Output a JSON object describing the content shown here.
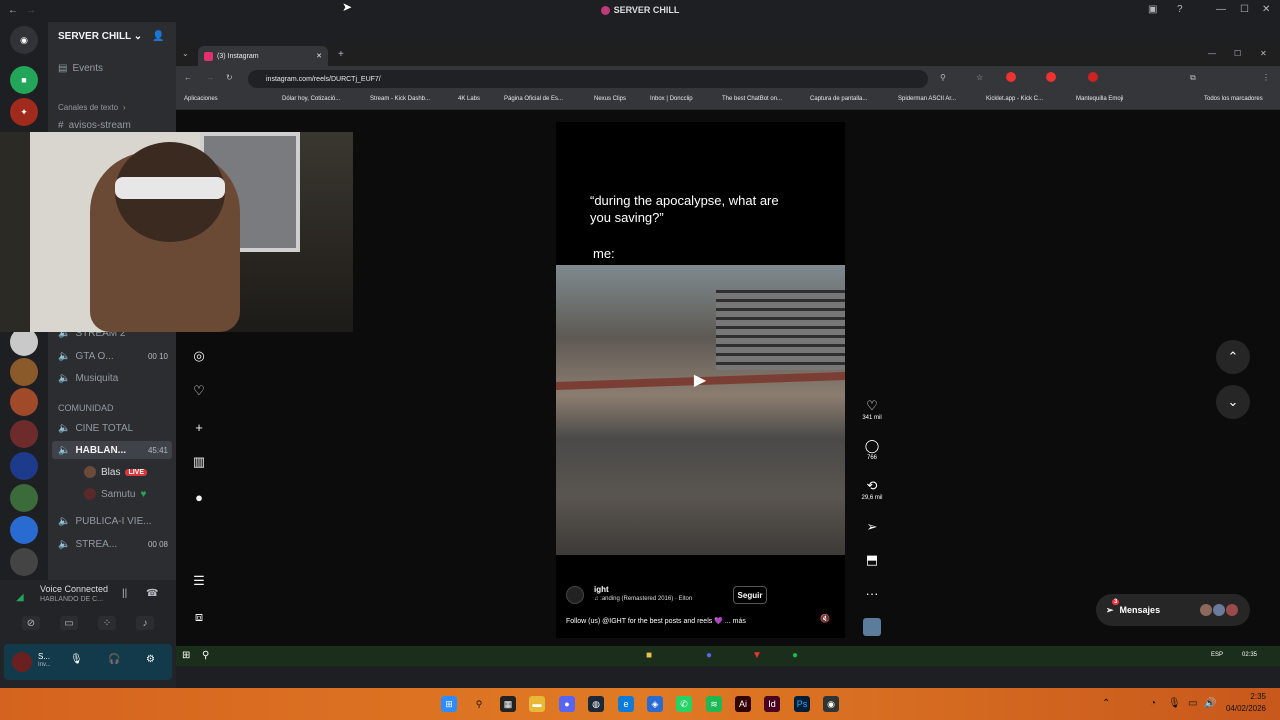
{
  "discord": {
    "window_title": "SERVER CHILL",
    "server_name": "SERVER CHILL",
    "events_label": "Events",
    "category_text": "Canales de texto",
    "text_channel": "avisos-stream",
    "voice_channels": [
      {
        "name": "STREAM 2",
        "count": ""
      },
      {
        "name": "GTA O...",
        "count": "00  10"
      },
      {
        "name": "Musiquita",
        "count": ""
      },
      {
        "name": "COMUNIDAD",
        "count": ""
      },
      {
        "name": "CINE TOTAL",
        "count": ""
      },
      {
        "name": "HABLAN...",
        "count": "45:41"
      },
      {
        "name": "PUBLICA-I VIE...",
        "count": ""
      },
      {
        "name": "STREA...",
        "count": "00  08"
      }
    ],
    "voice_users": [
      {
        "name": "Blas",
        "badge": "LIVE"
      },
      {
        "name": "Samutu",
        "badge": ""
      }
    ],
    "voice_connected": "Voice Connected",
    "voice_sub": "HABLANDO DE C...",
    "user_short": "S...",
    "user_status": "Inv..."
  },
  "chrome": {
    "tab_title": "(3) Instagram",
    "url": "instagram.com/reels/DURCTj_EUF7/",
    "bookmarks": [
      "Aplicaciones",
      "Dólar hoy, Cotizació...",
      "Stream - Kick Dashb...",
      "4K Labs",
      "Página Oficial de Es...",
      "Nexus Clips",
      "Inbox | Doncclip",
      "The best ChatBot on...",
      "Captura de pantalla...",
      "Spiderman ASCII Ar...",
      "Kicklet.app - Kick C...",
      "Mantequilla Emoji",
      "Todos los marcadores"
    ]
  },
  "reel": {
    "caption_line1": "“during the apocalypse, what are\n you saving?”",
    "caption_me": "me:",
    "likes": "341 mil",
    "comments": "766",
    "reposts": "29,6 mil",
    "author": "ight",
    "song": "♫ :anding (Remastered 2016) · Elton",
    "follow_label": "Seguir",
    "description": "Follow (us) @IGHT for the best posts and reels 💜 ... más",
    "more_icon": "···"
  },
  "messages_label": "Mensajes",
  "messages_badge": "3",
  "system": {
    "inner_lang": "ESP",
    "inner_time": "02:35",
    "time": "2:35",
    "date": "04/02/2026"
  }
}
